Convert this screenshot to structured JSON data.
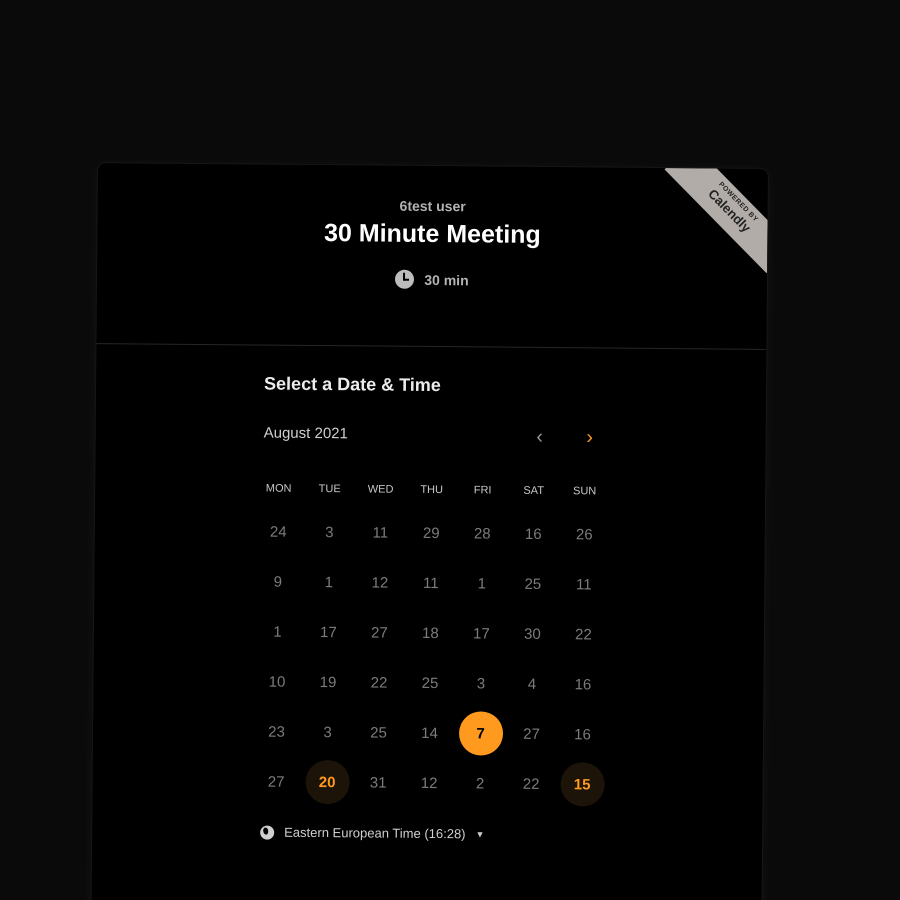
{
  "header": {
    "organizer": "6test user",
    "title": "30 Minute Meeting",
    "duration": "30 min",
    "duration_icon": "clock-icon"
  },
  "badge": {
    "small": "POWERED BY",
    "big": "Calendly"
  },
  "calendar": {
    "section_title": "Select a Date & Time",
    "month": "August 2021",
    "prev_icon": "chevron-left-icon",
    "next_icon": "chevron-right-icon",
    "weekdays": [
      "MON",
      "TUE",
      "WED",
      "THU",
      "FRI",
      "SAT",
      "SUN"
    ],
    "days": [
      "24",
      "3",
      "11",
      "29",
      "28",
      "16",
      "26",
      "9",
      "1",
      "12",
      "11",
      "1",
      "25",
      "11",
      "1",
      "17",
      "27",
      "18",
      "17",
      "30",
      "22",
      "10",
      "19",
      "22",
      "25",
      "3",
      "4",
      "16",
      "23",
      "3",
      "25",
      "14",
      "7",
      "27",
      "16",
      "27",
      "20",
      "31",
      "12",
      "2",
      "22",
      "15"
    ],
    "selected_day": "7",
    "available_days": [
      "20",
      "15"
    ],
    "accent_color": "#ff9a1f"
  },
  "timezone": {
    "icon": "globe-icon",
    "label": "Eastern European Time (16:28)"
  }
}
